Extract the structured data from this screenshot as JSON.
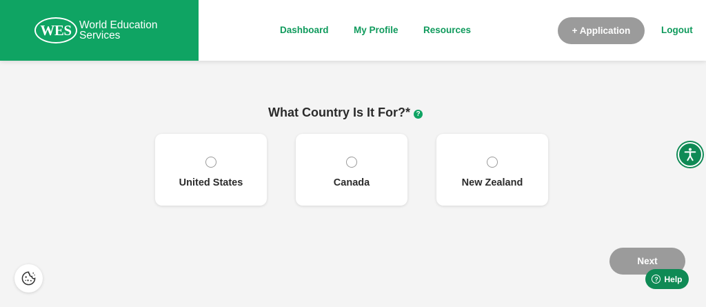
{
  "header": {
    "logo_text": "WES",
    "brand_line1": "World Education",
    "brand_line2": "Services",
    "nav": {
      "dashboard": "Dashboard",
      "my_profile": "My Profile",
      "resources": "Resources"
    },
    "application_button": "+ Application",
    "logout": "Logout"
  },
  "main": {
    "question": "What Country Is It For?*",
    "help_marker": "?",
    "options": [
      {
        "label": "United States",
        "selected": false
      },
      {
        "label": "Canada",
        "selected": false
      },
      {
        "label": "New Zealand",
        "selected": false
      }
    ]
  },
  "footer": {
    "next_button": "Next",
    "help_button": "Help",
    "help_icon_glyph": "?"
  },
  "icons": {
    "accessibility": "accessibility-icon",
    "cookie": "cookie-icon"
  },
  "colors": {
    "brand_green": "#0fa463",
    "nav_green": "#0f9a5c",
    "button_gray": "#9b9b9b",
    "dark_green": "#0f8a55"
  }
}
